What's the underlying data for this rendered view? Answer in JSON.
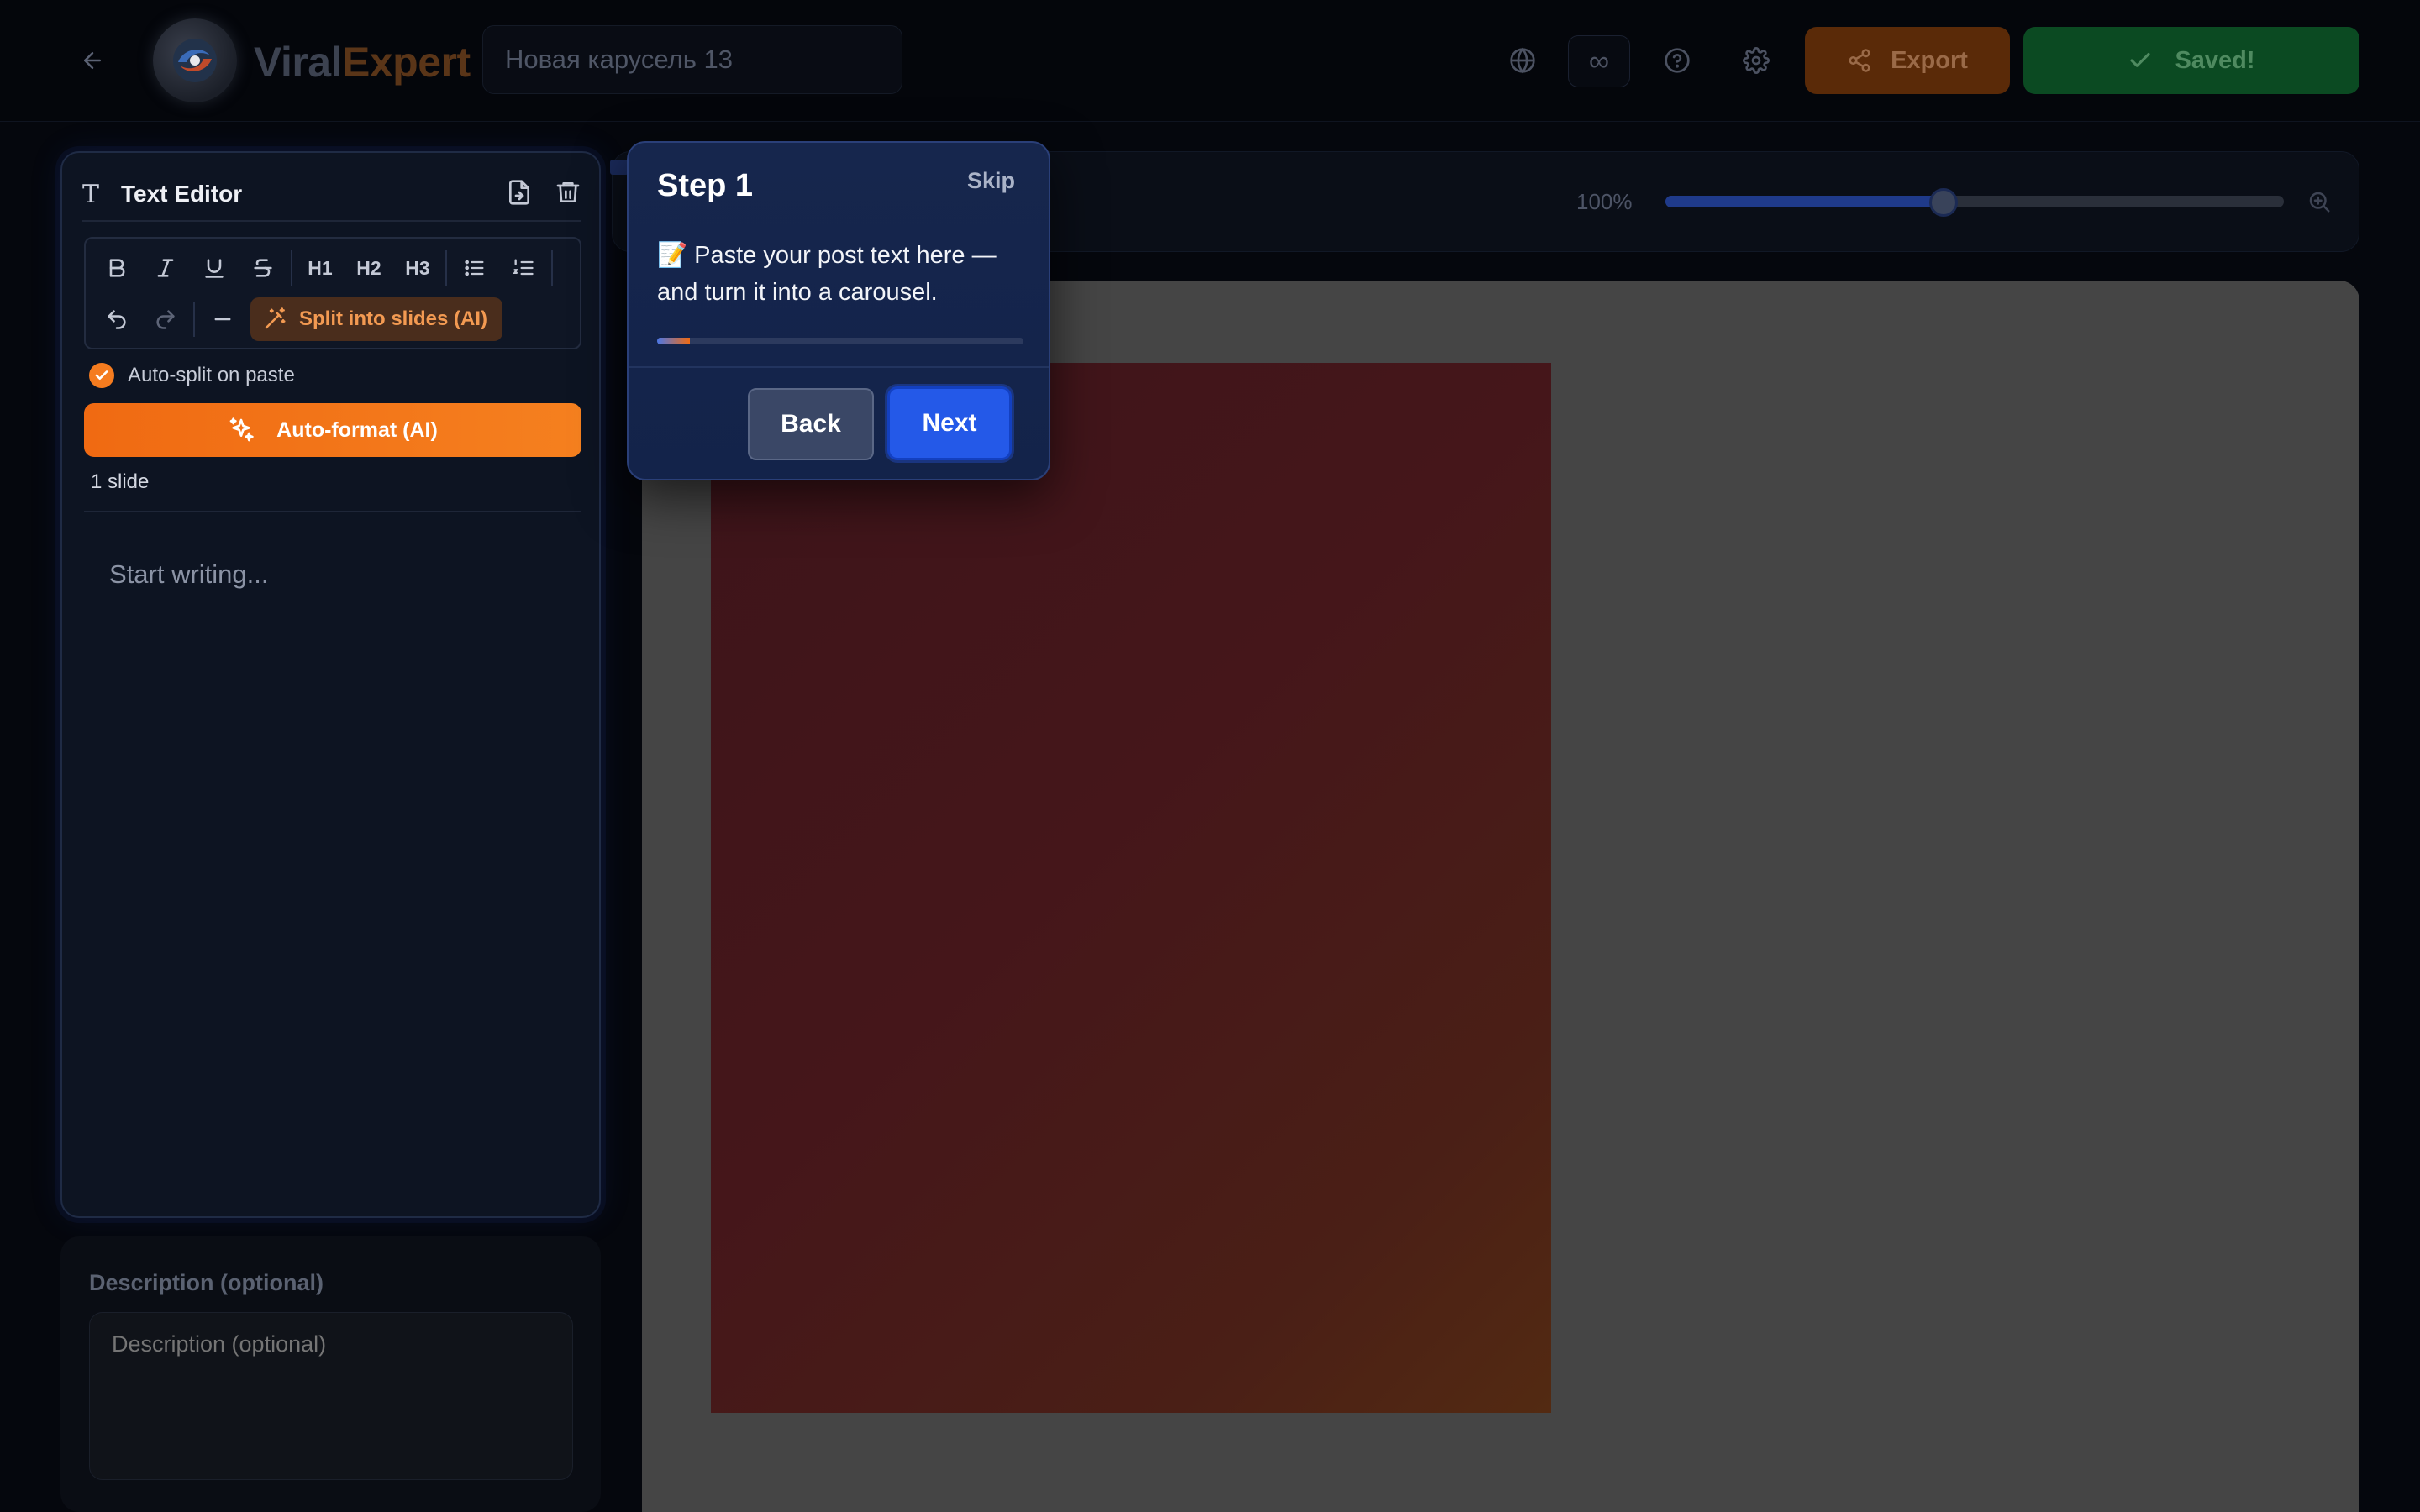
{
  "header": {
    "back_icon": "arrow-left-icon",
    "logo_part1": "Viral",
    "logo_part2": "Expert",
    "title_value": "Новая карусель 13",
    "icons": [
      "globe-icon",
      "infinity-icon",
      "help-circle-icon",
      "gear-icon"
    ],
    "infinity_glyph": "∞",
    "export_label": "Export",
    "saved_label": "Saved!"
  },
  "editor": {
    "title": "Text Editor",
    "toolbar": {
      "h1": "H1",
      "h2": "H2",
      "h3": "H3",
      "split_ai_label": "Split into slides (AI)"
    },
    "autosplit_label": "Auto-split on paste",
    "autosplit_checked": true,
    "autoformat_label": "Auto-format (AI)",
    "slide_count": "1 slide",
    "placeholder": "Start writing..."
  },
  "description": {
    "label": "Description (optional)",
    "placeholder": "Description (optional)"
  },
  "zoom": {
    "label": "100%",
    "level_fraction": 0.45
  },
  "tour": {
    "title": "Step 1",
    "skip_label": "Skip",
    "text": "📝 Paste your post text here — and turn it into a carousel.",
    "progress_fraction": 0.09,
    "back_label": "Back",
    "next_label": "Next"
  },
  "colors": {
    "accent_orange": "#f5801f",
    "saved_green": "#0b4a22",
    "tour_primary": "#2459e8"
  }
}
